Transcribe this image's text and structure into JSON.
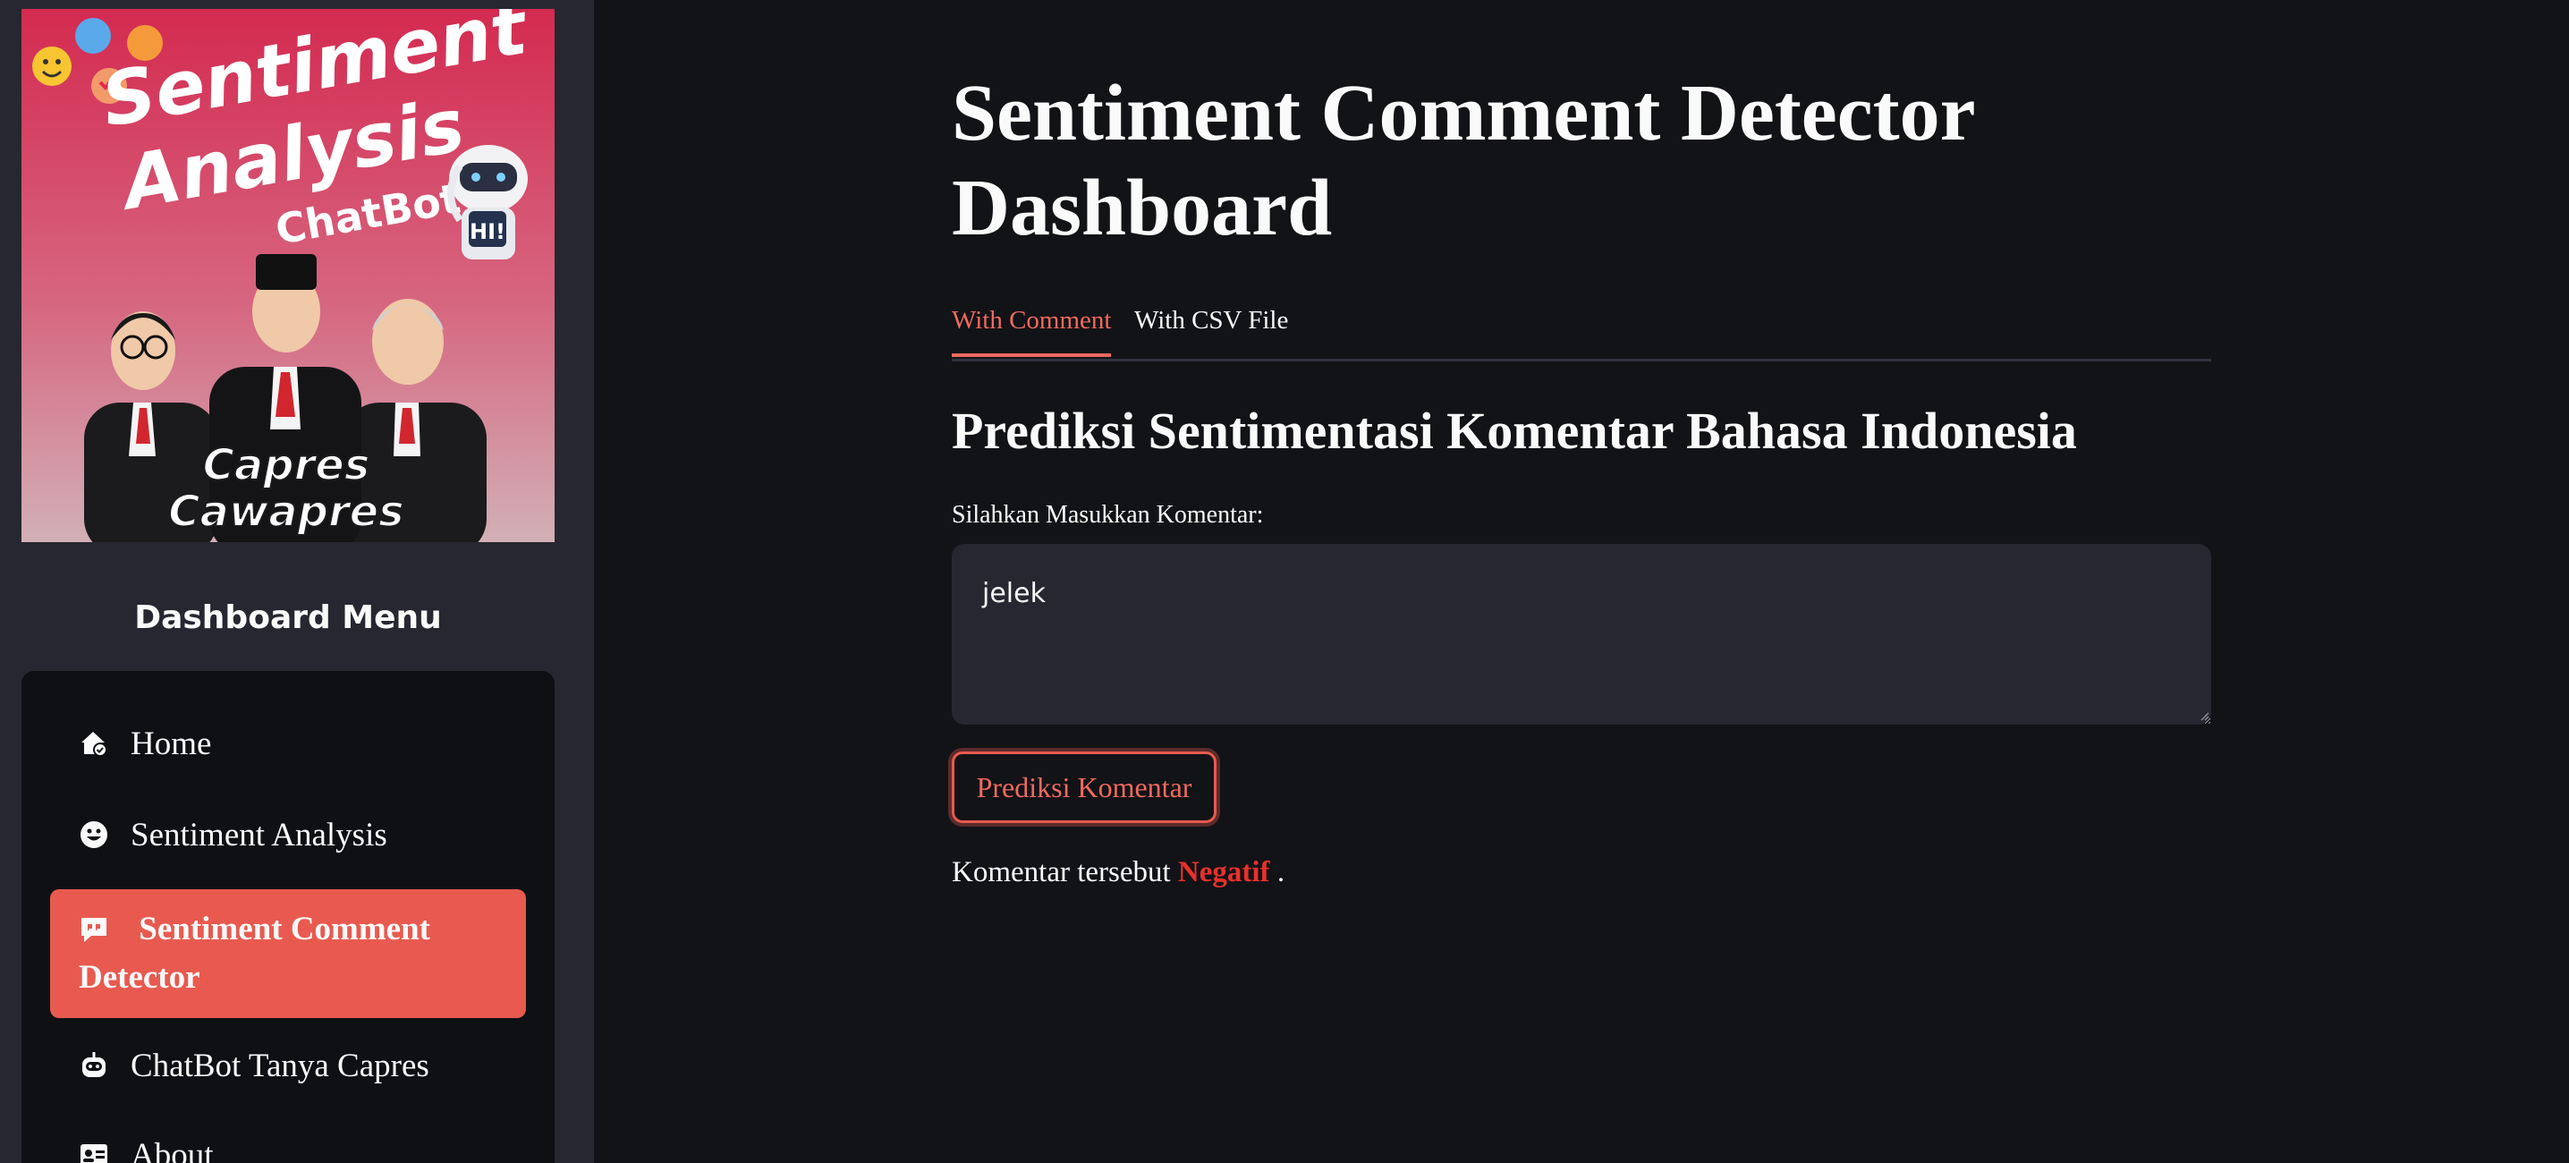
{
  "sidebar": {
    "poster": {
      "title_line1": "Sentiment",
      "title_line2": "Analysis",
      "subtitle": "ChatBot",
      "robot_text": "HI!",
      "caption_line1": "Capres",
      "caption_line2": "Cawapres"
    },
    "menu_title": "Dashboard Menu",
    "items": [
      {
        "label": "Home",
        "icon": "house-icon",
        "active": false
      },
      {
        "label": "Sentiment Analysis",
        "icon": "smile-icon",
        "active": false
      },
      {
        "label": "Sentiment Comment Detector",
        "icon": "comment-quote-icon",
        "active": true
      },
      {
        "label": "ChatBot Tanya Capres",
        "icon": "robot-icon",
        "active": false
      },
      {
        "label": "About",
        "icon": "id-card-icon",
        "active": false
      }
    ]
  },
  "main": {
    "title": "Sentiment Comment Detector Dashboard",
    "tabs": [
      {
        "label": "With Comment",
        "active": true
      },
      {
        "label": "With CSV File",
        "active": false
      }
    ],
    "heading": "Prediksi Sentimentasi Komentar Bahasa Indonesia",
    "input_label": "Silahkan Masukkan Komentar:",
    "comment_value": "jelek",
    "button_label": "Prediksi Komentar",
    "result_prefix": "Komentar tersebut",
    "result_value": "Negatif",
    "result_suffix": "."
  },
  "colors": {
    "accent": "#e85a4f",
    "negative": "#e8312b",
    "background": "#121317",
    "sidebar": "#262730"
  }
}
